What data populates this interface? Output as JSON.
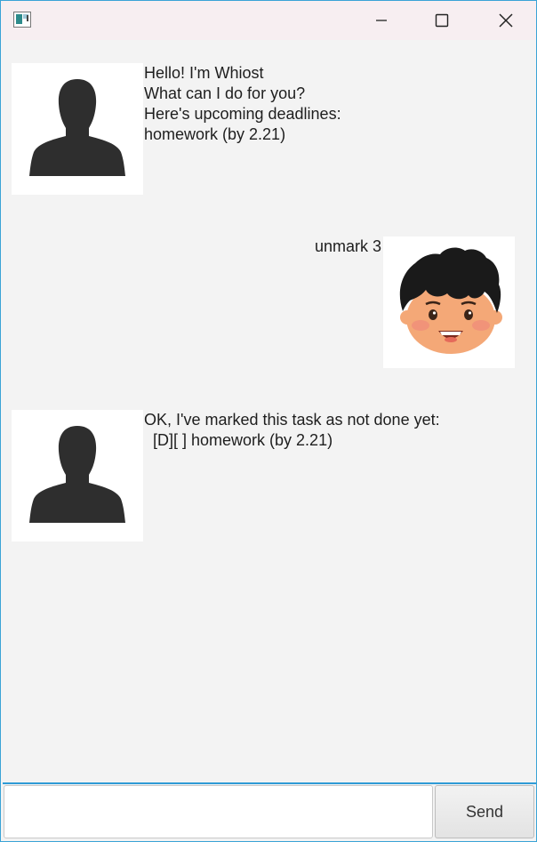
{
  "window": {
    "icon": "app-window-icon",
    "controls": [
      "minimize-icon",
      "maximize-icon",
      "close-icon"
    ]
  },
  "chat": {
    "messages": [
      {
        "sender": "bot",
        "avatar": "bot-avatar-silhouette-icon",
        "text": "Hello! I'm Whiost\nWhat can I do for you?\nHere's upcoming deadlines:\nhomework (by 2.21)"
      },
      {
        "sender": "user",
        "avatar": "user-avatar-boy-icon",
        "text": "unmark 3"
      },
      {
        "sender": "bot",
        "avatar": "bot-avatar-silhouette-icon",
        "text": "OK, I've marked this task as not done yet:\n  [D][ ] homework (by 2.21)"
      }
    ]
  },
  "input": {
    "value": "",
    "placeholder": ""
  },
  "send_button": {
    "label": "Send"
  },
  "colors": {
    "window_border": "#3aa3d6",
    "titlebar_bg": "#f7eef1",
    "chat_bg": "#f3f3f3",
    "silhouette": "#2e2e2e",
    "hair": "#1a1a1a",
    "skin": "#f4a877"
  }
}
